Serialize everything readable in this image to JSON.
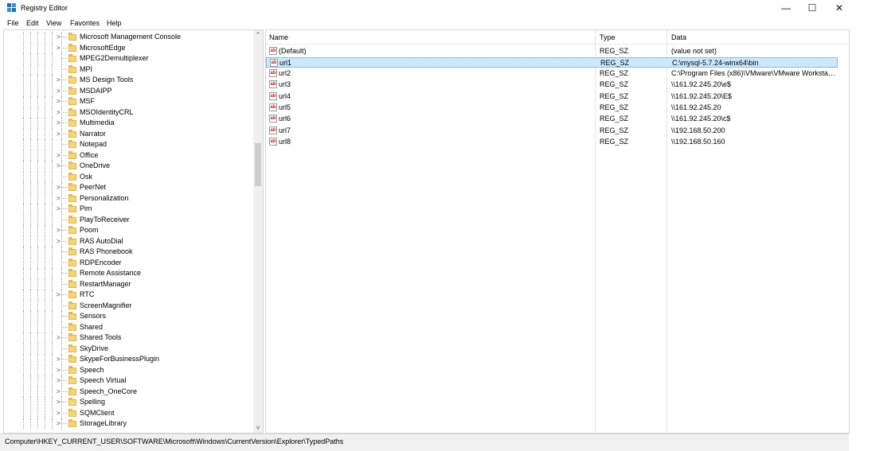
{
  "window": {
    "title": "Registry Editor",
    "icon": "registry-editor-icon"
  },
  "controls": {
    "minimize": "—",
    "maximize": "☐",
    "close": "✕"
  },
  "menu": [
    "File",
    "Edit",
    "View",
    "Favorites",
    "Help"
  ],
  "tree": {
    "items": [
      {
        "label": "Microsoft Management Console",
        "expandable": true
      },
      {
        "label": "MicrosoftEdge",
        "expandable": true
      },
      {
        "label": "MPEG2Demultiplexer",
        "expandable": false
      },
      {
        "label": "MPI",
        "expandable": false
      },
      {
        "label": "MS Design Tools",
        "expandable": true
      },
      {
        "label": "MSDAIPP",
        "expandable": true
      },
      {
        "label": "MSF",
        "expandable": true
      },
      {
        "label": "MSOIdentityCRL",
        "expandable": true
      },
      {
        "label": "Multimedia",
        "expandable": true
      },
      {
        "label": "Narrator",
        "expandable": true
      },
      {
        "label": "Notepad",
        "expandable": false
      },
      {
        "label": "Office",
        "expandable": true
      },
      {
        "label": "OneDrive",
        "expandable": true
      },
      {
        "label": "Osk",
        "expandable": false
      },
      {
        "label": "PeerNet",
        "expandable": true
      },
      {
        "label": "Personalization",
        "expandable": true
      },
      {
        "label": "Pim",
        "expandable": true
      },
      {
        "label": "PlayToReceiver",
        "expandable": false
      },
      {
        "label": "Poom",
        "expandable": true
      },
      {
        "label": "RAS AutoDial",
        "expandable": true
      },
      {
        "label": "RAS Phonebook",
        "expandable": false
      },
      {
        "label": "RDPEncoder",
        "expandable": false
      },
      {
        "label": "Remote Assistance",
        "expandable": false
      },
      {
        "label": "RestartManager",
        "expandable": false
      },
      {
        "label": "RTC",
        "expandable": true
      },
      {
        "label": "ScreenMagnifier",
        "expandable": false
      },
      {
        "label": "Sensors",
        "expandable": false
      },
      {
        "label": "Shared",
        "expandable": false
      },
      {
        "label": "Shared Tools",
        "expandable": true
      },
      {
        "label": "SkyDrive",
        "expandable": false
      },
      {
        "label": "SkypeForBusinessPlugin",
        "expandable": true
      },
      {
        "label": "Speech",
        "expandable": true
      },
      {
        "label": "Speech Virtual",
        "expandable": true
      },
      {
        "label": "Speech_OneCore",
        "expandable": true
      },
      {
        "label": "Spelling",
        "expandable": true
      },
      {
        "label": "SQMClient",
        "expandable": true
      },
      {
        "label": "StorageLibrary",
        "expandable": true
      }
    ],
    "scroll_up": "^",
    "scroll_down": "v"
  },
  "list": {
    "columns": {
      "name": "Name",
      "type": "Type",
      "data": "Data"
    },
    "rows": [
      {
        "name": "(Default)",
        "type": "REG_SZ",
        "data": "(value not set)",
        "selected": false
      },
      {
        "name": "url1",
        "type": "REG_SZ",
        "data": "C:\\mysql-5.7.24-winx64\\bin",
        "selected": true
      },
      {
        "name": "url2",
        "type": "REG_SZ",
        "data": "C:\\Program Files (x86)\\VMware\\VMware Workstati...",
        "selected": false
      },
      {
        "name": "url3",
        "type": "REG_SZ",
        "data": "\\\\161.92.245.20\\e$",
        "selected": false
      },
      {
        "name": "url4",
        "type": "REG_SZ",
        "data": "\\\\161.92.245.20\\E$",
        "selected": false
      },
      {
        "name": "url5",
        "type": "REG_SZ",
        "data": "\\\\161.92.245.20",
        "selected": false
      },
      {
        "name": "url6",
        "type": "REG_SZ",
        "data": "\\\\161.92.245.20\\c$",
        "selected": false
      },
      {
        "name": "url7",
        "type": "REG_SZ",
        "data": "\\\\192.168.50.200",
        "selected": false
      },
      {
        "name": "url8",
        "type": "REG_SZ",
        "data": "\\\\192.168.50.160",
        "selected": false
      }
    ],
    "value_icon_text": "ab"
  },
  "status": {
    "path": "Computer\\HKEY_CURRENT_USER\\SOFTWARE\\Microsoft\\Windows\\CurrentVersion\\Explorer\\TypedPaths"
  }
}
